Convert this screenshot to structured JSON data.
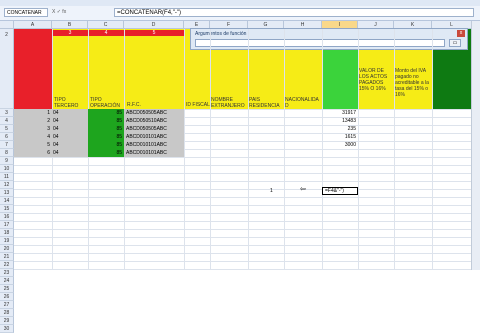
{
  "name_box": "CONCATENAR",
  "formula_bar": "=CONCATENAR(F4,\"-\")",
  "fx_label": "X ✓ fx",
  "dialog": {
    "title": "Argumentos de función",
    "input_value": "",
    "collapse_label": "▭",
    "close_label": "x"
  },
  "columns": [
    {
      "label": "A"
    },
    {
      "label": "B"
    },
    {
      "label": "C"
    },
    {
      "label": "D"
    },
    {
      "label": "E"
    },
    {
      "label": "F"
    },
    {
      "label": "G"
    },
    {
      "label": "H"
    },
    {
      "label": "I"
    },
    {
      "label": "J"
    },
    {
      "label": "K"
    },
    {
      "label": "L"
    }
  ],
  "rows": [
    "2",
    "3",
    "4",
    "5",
    "6",
    "7",
    "8",
    "9",
    "10",
    "11",
    "12",
    "13",
    "14",
    "15",
    "16",
    "17",
    "18",
    "19",
    "20",
    "21",
    "22",
    "23",
    "24",
    "25",
    "26",
    "27",
    "28",
    "29",
    "30"
  ],
  "headers": {
    "tipo_tercero": "TIPO TERCERO",
    "tipo_operacion": "TIPO OPERACIÓN",
    "rfc": "R.F.C.",
    "id_fiscal": "ID FISCAL",
    "nombre_extranjero": "NOMBRE EXTRANJERO",
    "pais_residencia": "PAIS RESIDENCIA",
    "nacionalidad": "NACIONALIDA D",
    "valor_actos": "VALOR DE LOS ACTOS PAGADOS 15% O 16%",
    "monto_iva": "Monto del IVA pagado no acreditable a la tasa del 15% o 16%"
  },
  "header_nums": {
    "b": "3",
    "c": "4",
    "d": "5"
  },
  "data_rows": [
    {
      "n": "1",
      "tipo": "04",
      "op": "85",
      "rfc": "ABCD050505ABC",
      "valor": "31917"
    },
    {
      "n": "2",
      "tipo": "04",
      "op": "85",
      "rfc": "ABCD050510ABC",
      "valor": "13483"
    },
    {
      "n": "3",
      "tipo": "04",
      "op": "85",
      "rfc": "ABCD050505ABC",
      "valor": "235"
    },
    {
      "n": "4",
      "tipo": "04",
      "op": "85",
      "rfc": "ABCD010101ABC",
      "valor": "1615"
    },
    {
      "n": "5",
      "tipo": "04",
      "op": "85",
      "rfc": "ABCD010101ABC",
      "valor": "3000"
    },
    {
      "n": "6",
      "tipo": "04",
      "op": "85",
      "rfc": "ABCD010101ABC",
      "valor": ""
    }
  ],
  "active_cell": "=F4&\"-\")",
  "stray": "1",
  "colors": {
    "red": "#e8202a",
    "yellow": "#f6ec16",
    "green": "#1ea51e",
    "dark_green": "#0e7a12",
    "light_green": "#3bd33b"
  }
}
